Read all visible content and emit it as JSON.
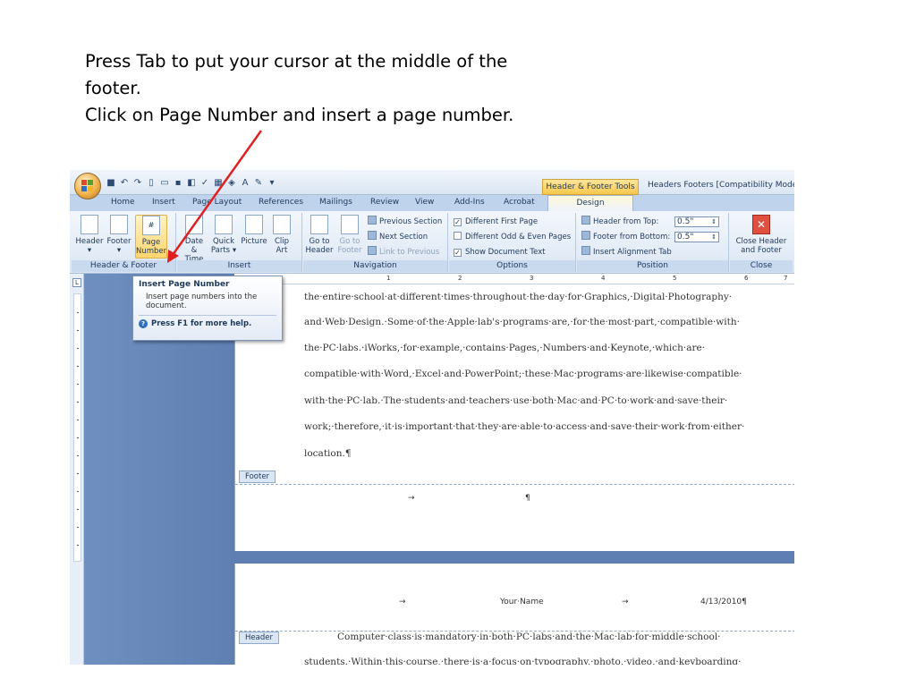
{
  "instructions": [
    "Press Tab to put your cursor at the middle of the",
    "footer.",
    "Click on Page Number and insert a page number."
  ],
  "accent_color": "#e02020",
  "window": {
    "contextual_tab": "Header & Footer Tools",
    "title": "Headers Footers [Compatibility Mode] -"
  },
  "tabs": [
    "Home",
    "Insert",
    "Page Layout",
    "References",
    "Mailings",
    "Review",
    "View",
    "Add-Ins",
    "Acrobat",
    "Design"
  ],
  "ribbon": {
    "header_footer": {
      "label": "Header & Footer",
      "header": "Header",
      "footer": "Footer",
      "page": "Page",
      "number": "Number"
    },
    "insert": {
      "label": "Insert",
      "date1": "Date",
      "date2": "& Time",
      "quick1": "Quick",
      "quick2": "Parts",
      "picture": "Picture",
      "clip1": "Clip",
      "clip2": "Art"
    },
    "navigation": {
      "label": "Navigation",
      "goto1a": "Go to",
      "goto1b": "Header",
      "goto2a": "Go to",
      "goto2b": "Footer",
      "prev_section": "Previous Section",
      "next_section": "Next Section",
      "link_previous": "Link to Previous"
    },
    "options": {
      "label": "Options",
      "different_first": "Different First Page",
      "different_odd_even": "Different Odd & Even Pages",
      "show_doc_text": "Show Document Text"
    },
    "position": {
      "label": "Position",
      "header_from_top": "Header from Top:",
      "header_value": "0.5\"",
      "footer_from_bottom": "Footer from Bottom:",
      "footer_value": "0.5\"",
      "insert_alignment": "Insert Alignment Tab"
    },
    "close": {
      "label": "Close",
      "btn1": "Close Header",
      "btn2": "and Footer"
    }
  },
  "tooltip": {
    "title": "Insert Page Number",
    "desc1": "Insert page numbers into the",
    "desc2": "document.",
    "help": "Press F1 for more help."
  },
  "ruler": [
    "1",
    "2",
    "3",
    "4",
    "5",
    "6",
    "7"
  ],
  "document": {
    "lines": [
      "the·entire·school·at·different·times·throughout·the·day·for·Graphics,·Digital·Photography·",
      "and·Web·Design.·Some·of·the·Apple·lab's·programs·are,·for·the·most·part,·compatible·with·",
      "the·PC·labs.·iWorks,·for·example,·contains·Pages,·Numbers·and·Keynote,·which·are·",
      "compatible·with·Word,·Excel·and·PowerPoint;·these·Mac·programs·are·likewise·compatible·",
      "with·the·PC·lab.·The·students·and·teachers·use·both·Mac·and·PC·to·work·and·save·their·",
      "work;·therefore,·it·is·important·that·they·are·able·to·access·and·save·their·work·from·either·",
      "location.¶"
    ],
    "footer_tag": "Footer",
    "tab_arrow": "→",
    "pilcrow": "¶",
    "header_tag": "Header",
    "header_name": "Your·Name",
    "header_date": "4/13/2010¶",
    "page2_line1": "Computer·class·is·mandatory·in·both·PC·labs·and·the·Mac·lab·for·middle·school·",
    "page2_line2": "students.·Within·this·course,·there·is·a·focus·on·typography,·photo,·video,·and·keyboarding·"
  }
}
